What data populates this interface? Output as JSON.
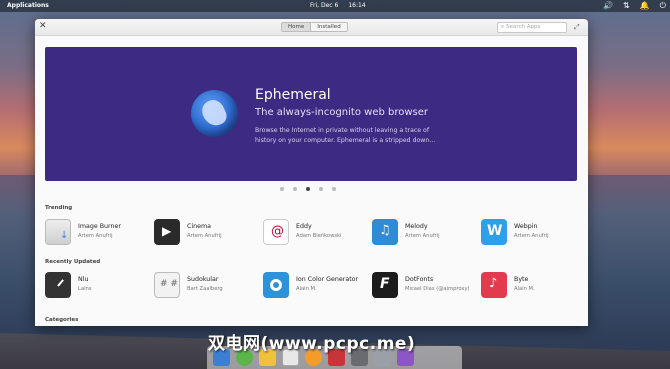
{
  "panel": {
    "applications": "Applications",
    "date": "Fri, Dec 6",
    "time": "16:14",
    "tray": [
      "volume-icon",
      "network-icon",
      "notifications-icon",
      "power-icon"
    ]
  },
  "window": {
    "tabs": [
      {
        "label": "Home",
        "active": true
      },
      {
        "label": "Installed",
        "active": false
      }
    ],
    "search_placeholder": "Search Apps"
  },
  "banner": {
    "title": "Ephemeral",
    "subtitle": "The always-incognito web browser",
    "description": "Browse the Internet in private without leaving a trace of history on your computer. Ephemeral is a stripped down...",
    "background": "#3d2a82",
    "pages": 5,
    "current_page": 3
  },
  "trending": {
    "title": "Trending",
    "apps": [
      {
        "name": "Image Burner",
        "developer": "Artem Anufrij",
        "icon": "image-burner-icon"
      },
      {
        "name": "Cinema",
        "developer": "Artem Anufrij",
        "icon": "cinema-icon"
      },
      {
        "name": "Eddy",
        "developer": "Adam Bieńkowski",
        "icon": "eddy-icon"
      },
      {
        "name": "Melody",
        "developer": "Artem Anufrij",
        "icon": "melody-icon"
      },
      {
        "name": "Webpin",
        "developer": "Artem Anufrij",
        "icon": "webpin-icon"
      }
    ]
  },
  "recently_updated": {
    "title": "Recently Updated",
    "apps": [
      {
        "name": "Nlu",
        "developer": "Lains",
        "icon": "nlu-icon"
      },
      {
        "name": "Sudokular",
        "developer": "Bart Zaalberg",
        "icon": "sudokular-icon"
      },
      {
        "name": "Ion Color Generator",
        "developer": "Alain M.",
        "icon": "ion-color-generator-icon"
      },
      {
        "name": "DotFonts",
        "developer": "Micael Dias (@aimproxy)",
        "icon": "dotfonts-icon"
      },
      {
        "name": "Byte",
        "developer": "Alain M.",
        "icon": "byte-icon"
      }
    ]
  },
  "categories": {
    "title": "Categories"
  },
  "watermark": "双电网(www.pcpc.me)"
}
